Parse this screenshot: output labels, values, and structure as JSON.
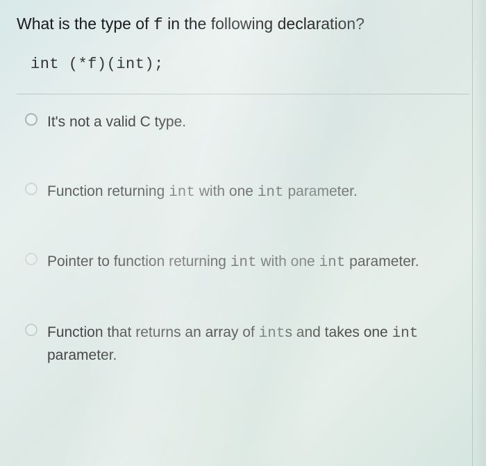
{
  "question": {
    "prefix": "What is the type of ",
    "variable": "f",
    "suffix": " in the following declaration?"
  },
  "code": "int (*f)(int);",
  "options": [
    {
      "parts": [
        {
          "text": "It's not a valid C type.",
          "mono": false
        }
      ]
    },
    {
      "parts": [
        {
          "text": "Function returning ",
          "mono": false
        },
        {
          "text": "int",
          "mono": true
        },
        {
          "text": " with one ",
          "mono": false
        },
        {
          "text": "int",
          "mono": true
        },
        {
          "text": " parameter.",
          "mono": false
        }
      ]
    },
    {
      "parts": [
        {
          "text": "Pointer to function returning ",
          "mono": false
        },
        {
          "text": "int",
          "mono": true
        },
        {
          "text": " with one ",
          "mono": false
        },
        {
          "text": "int",
          "mono": true
        },
        {
          "text": " parameter.",
          "mono": false
        }
      ]
    },
    {
      "parts": [
        {
          "text": "Function that returns an array of ",
          "mono": false
        },
        {
          "text": "int",
          "mono": true
        },
        {
          "text": "s and takes one ",
          "mono": false
        },
        {
          "text": "int",
          "mono": true
        },
        {
          "text": " parameter.",
          "mono": false
        }
      ]
    }
  ]
}
